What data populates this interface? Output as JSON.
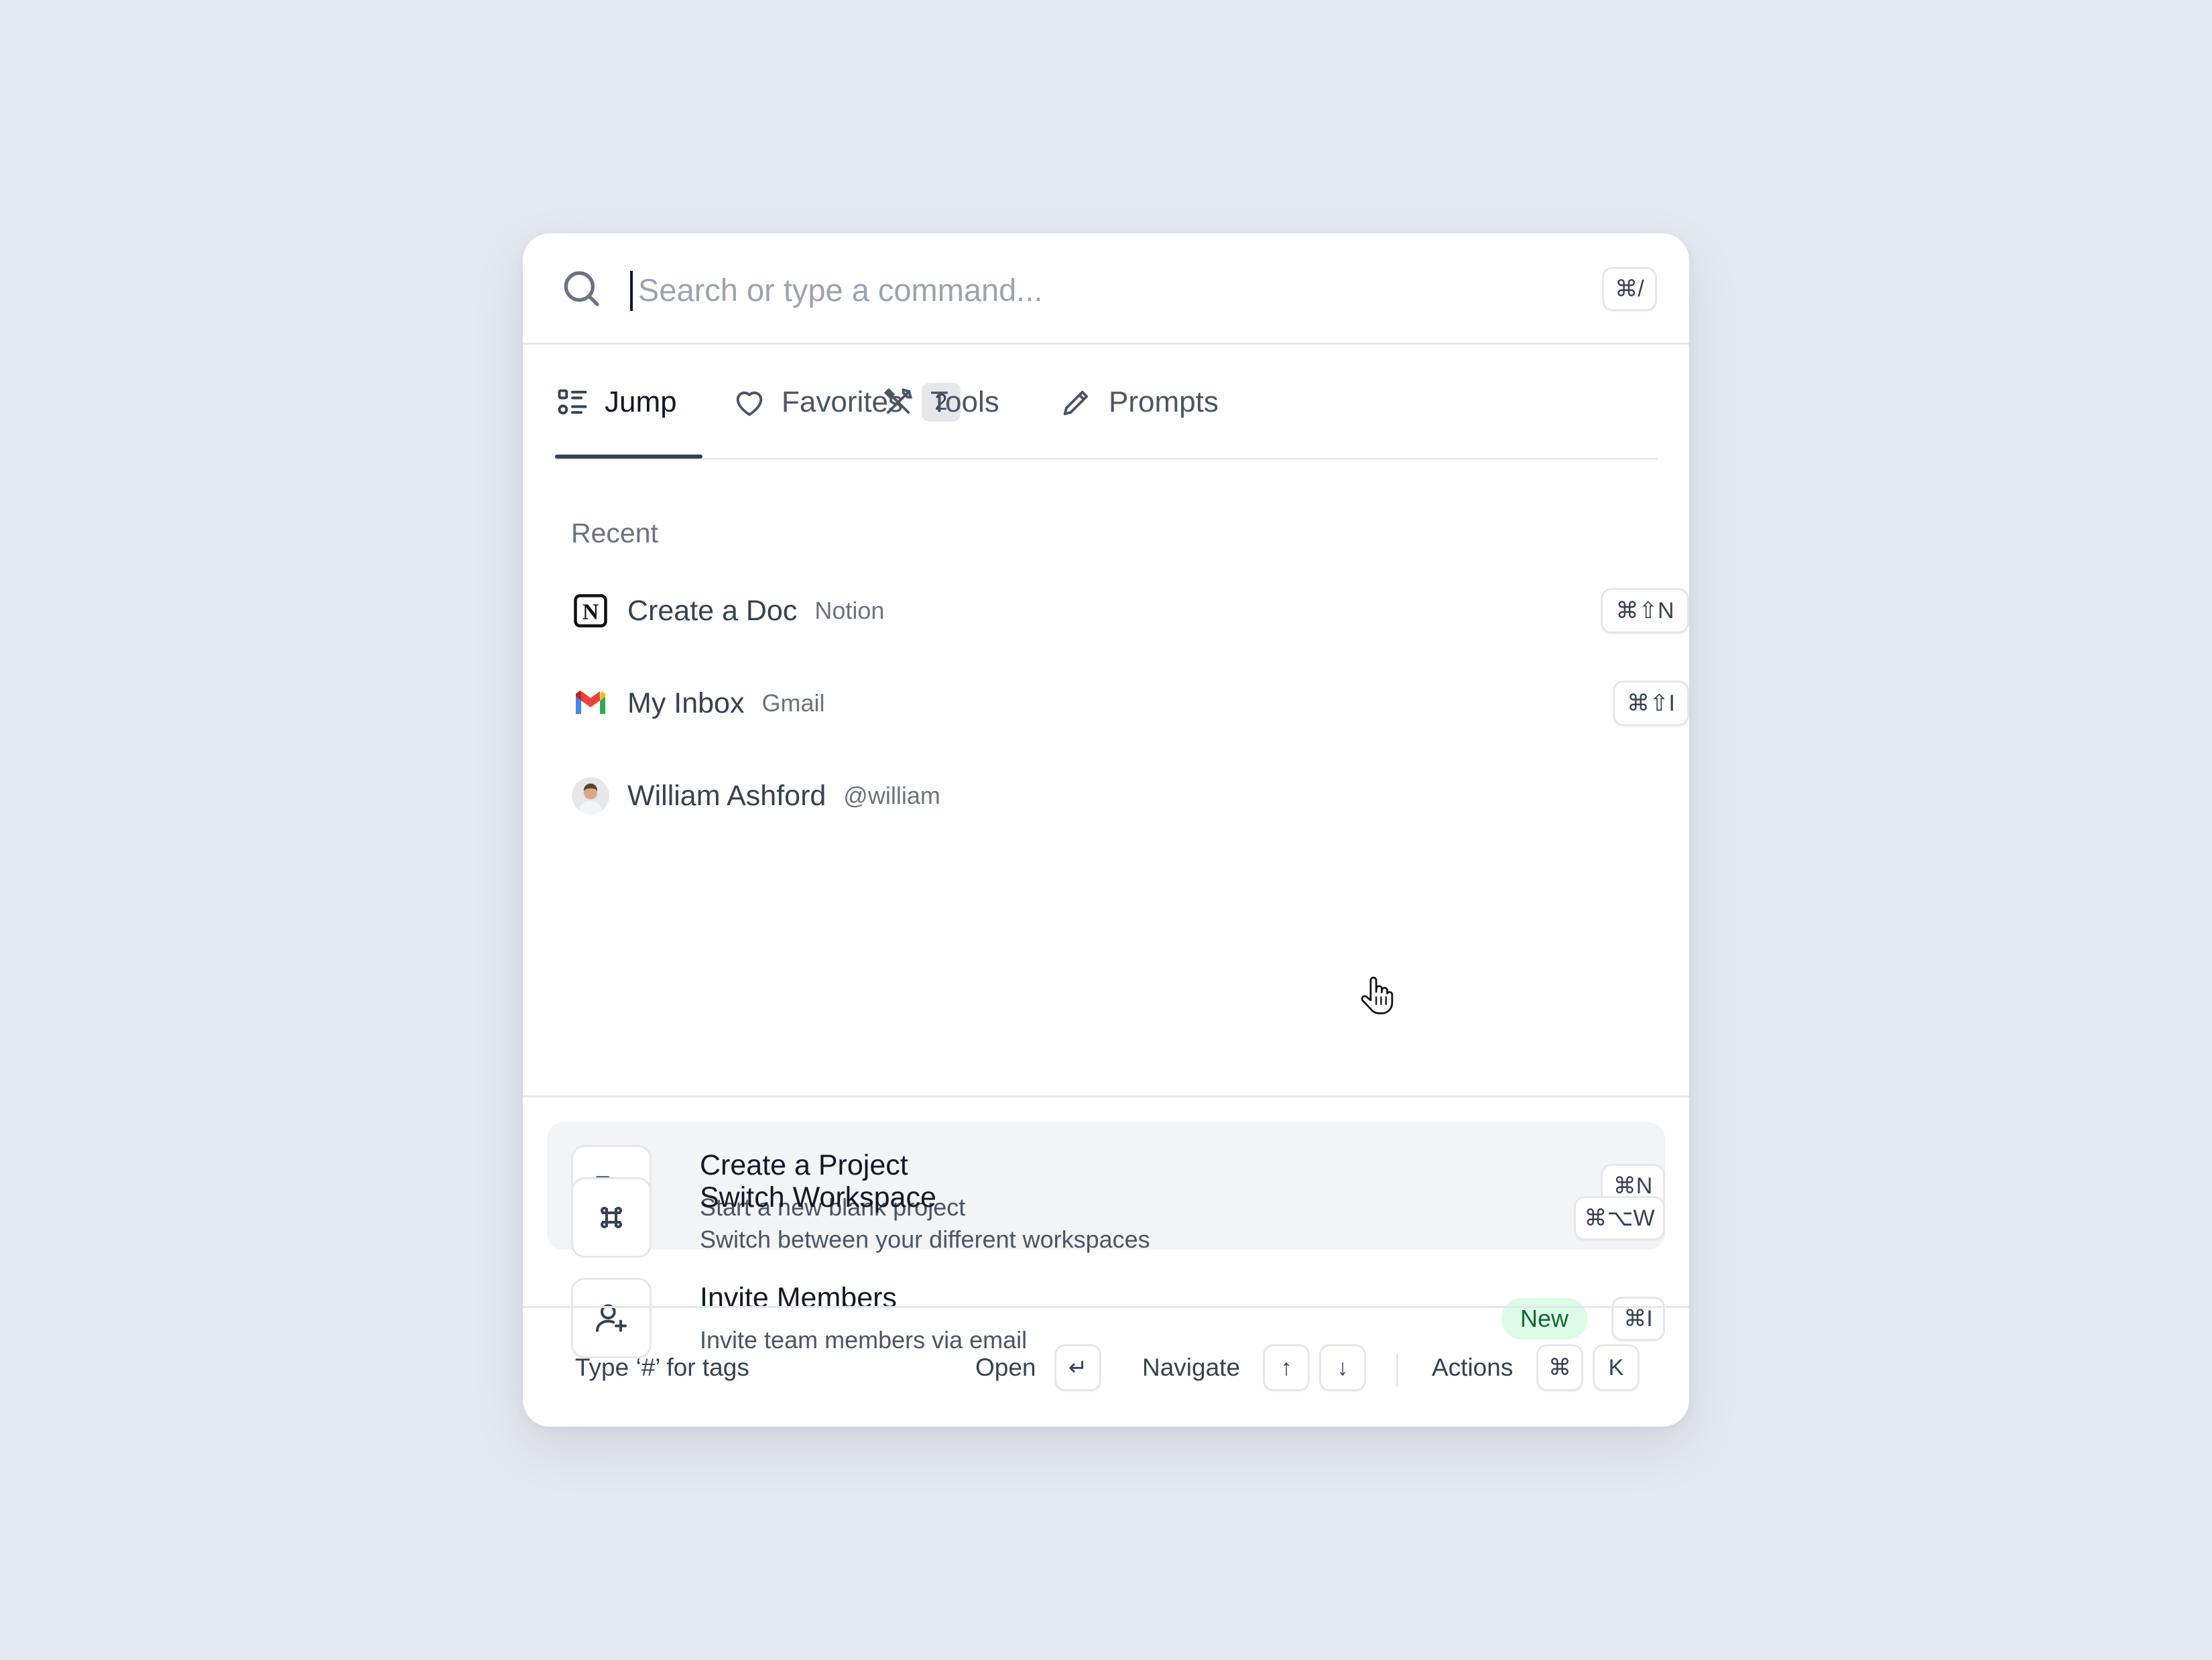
{
  "search": {
    "placeholder": "Search or type a command...",
    "shortcut": "⌘/"
  },
  "tabs": [
    {
      "label": "Jump",
      "icon": "list-icon",
      "active": true
    },
    {
      "label": "Favorites",
      "icon": "heart-icon",
      "badge": "2"
    },
    {
      "label": "Tools",
      "icon": "tools-icon"
    },
    {
      "label": "Prompts",
      "icon": "pencil-icon"
    }
  ],
  "recent": {
    "title": "Recent",
    "items": [
      {
        "title": "Create a Doc",
        "sub": "Notion",
        "icon": "notion-icon",
        "shortcut": "⌘⇧N"
      },
      {
        "title": "My Inbox",
        "sub": "Gmail",
        "icon": "gmail-icon",
        "shortcut": "⌘⇧I"
      },
      {
        "title": "William Ashford",
        "sub": "@william",
        "icon": "avatar"
      }
    ]
  },
  "commands": [
    {
      "title": "Create a Project",
      "sub": "Start a new blank project",
      "icon": "folder-plus-icon",
      "shortcut": "⌘N",
      "highlighted": true
    },
    {
      "title": "Invite Members",
      "sub": "Invite team members via email",
      "icon": "user-plus-icon",
      "badge": "New",
      "shortcut": "⌘I"
    },
    {
      "title": "Switch Workspace",
      "sub": "Switch between your different workspaces",
      "icon": "command-icon",
      "shortcut": "⌘⌥W"
    }
  ],
  "footer": {
    "hint": "Type ‘#’ for tags",
    "open_label": "Open",
    "open_key": "↵",
    "navigate_label": "Navigate",
    "up_key": "↑",
    "down_key": "↓",
    "actions_label": "Actions",
    "actions_key1": "⌘",
    "actions_key2": "K"
  },
  "colors": {
    "background": "#e5e9f0",
    "new_badge_bg": "#dcfce7",
    "new_badge_text": "#166534"
  }
}
